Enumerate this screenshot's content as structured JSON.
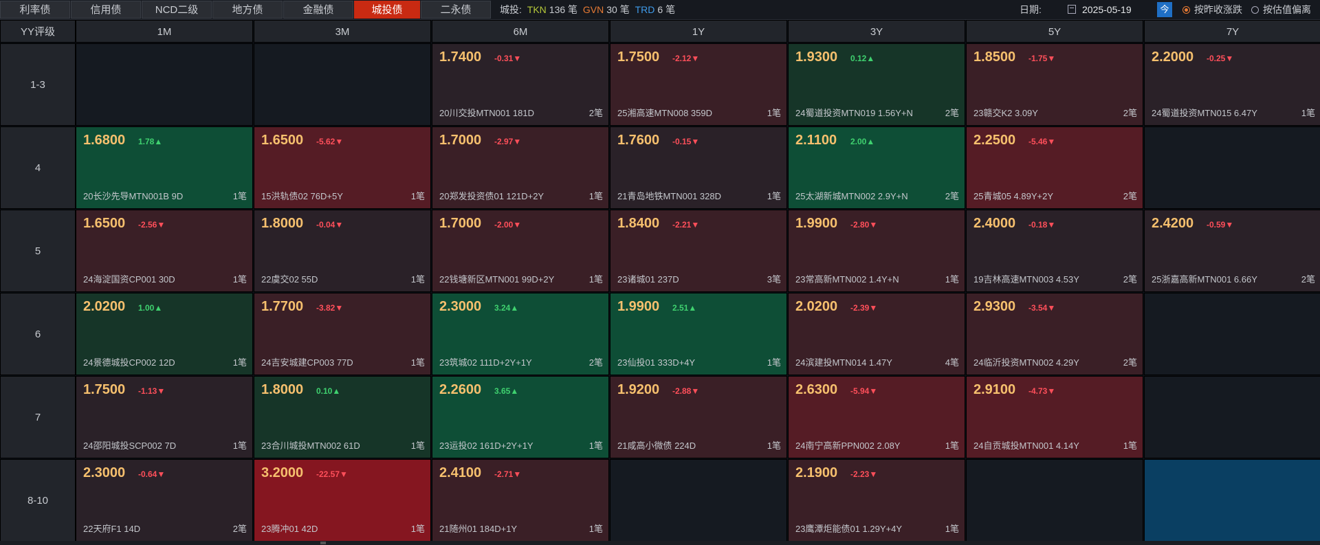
{
  "tabs": [
    {
      "label": "利率债",
      "active": false
    },
    {
      "label": "信用债",
      "active": false
    },
    {
      "label": "NCD二级",
      "active": false
    },
    {
      "label": "地方债",
      "active": false
    },
    {
      "label": "金融债",
      "active": false
    },
    {
      "label": "城投债",
      "active": true
    },
    {
      "label": "二永债",
      "active": false
    }
  ],
  "counts": {
    "prefix": "城投:",
    "tkn_label": "TKN",
    "tkn_value": "136 笔",
    "gvn_label": "GVN",
    "gvn_value": "30 笔",
    "trd_label": "TRD",
    "trd_value": "6 笔"
  },
  "date": {
    "label": "日期:",
    "value": "2025-05-19",
    "today_label": "今"
  },
  "radios": [
    {
      "label": "按昨收涨跌",
      "checked": true
    },
    {
      "label": "按估值偏离",
      "checked": false
    }
  ],
  "grid": {
    "corner": "YY评级",
    "columns": [
      "1M",
      "3M",
      "6M",
      "1Y",
      "3Y",
      "5Y",
      "7Y"
    ],
    "rows": [
      {
        "label": "1-3",
        "cells": [
          null,
          null,
          {
            "yield": "1.7400",
            "change": "-0.31▼",
            "dir": "dn",
            "bond": "20川交投MTN001 181D",
            "count": "2笔",
            "tone": "c-neutral"
          },
          {
            "yield": "1.7500",
            "change": "-2.12▼",
            "dir": "dn",
            "bond": "25湘高速MTN008 359D",
            "count": "1笔",
            "tone": "c-red1"
          },
          {
            "yield": "1.9300",
            "change": "0.12▲",
            "dir": "up",
            "bond": "24蜀道投资MTN019 1.56Y+N",
            "count": "2笔",
            "tone": "c-green1"
          },
          {
            "yield": "1.8500",
            "change": "-1.75▼",
            "dir": "dn",
            "bond": "23赣交K2 3.09Y",
            "count": "2笔",
            "tone": "c-red1"
          },
          {
            "yield": "2.2000",
            "change": "-0.25▼",
            "dir": "dn",
            "bond": "24蜀道投资MTN015 6.47Y",
            "count": "1笔",
            "tone": "c-neutral"
          }
        ]
      },
      {
        "label": "4",
        "cells": [
          {
            "yield": "1.6800",
            "change": "1.78▲",
            "dir": "up",
            "bond": "20长沙先导MTN001B 9D",
            "count": "1笔",
            "tone": "c-green2"
          },
          {
            "yield": "1.6500",
            "change": "-5.62▼",
            "dir": "dn",
            "bond": "15洪轨债02 76D+5Y",
            "count": "1笔",
            "tone": "c-red2"
          },
          {
            "yield": "1.7000",
            "change": "-2.97▼",
            "dir": "dn",
            "bond": "20郑发投资债01 121D+2Y",
            "count": "1笔",
            "tone": "c-red1"
          },
          {
            "yield": "1.7600",
            "change": "-0.15▼",
            "dir": "dn",
            "bond": "21青岛地铁MTN001 328D",
            "count": "1笔",
            "tone": "c-neutral"
          },
          {
            "yield": "2.1100",
            "change": "2.00▲",
            "dir": "up",
            "bond": "25太湖新城MTN002 2.9Y+N",
            "count": "2笔",
            "tone": "c-green2"
          },
          {
            "yield": "2.2500",
            "change": "-5.46▼",
            "dir": "dn",
            "bond": "25青城05 4.89Y+2Y",
            "count": "2笔",
            "tone": "c-red2"
          },
          null
        ]
      },
      {
        "label": "5",
        "cells": [
          {
            "yield": "1.6500",
            "change": "-2.56▼",
            "dir": "dn",
            "bond": "24海淀国资CP001 30D",
            "count": "1笔",
            "tone": "c-red1"
          },
          {
            "yield": "1.8000",
            "change": "-0.04▼",
            "dir": "dn",
            "bond": "22虞交02 55D",
            "count": "1笔",
            "tone": "c-neutral"
          },
          {
            "yield": "1.7000",
            "change": "-2.00▼",
            "dir": "dn",
            "bond": "22钱塘新区MTN001 99D+2Y",
            "count": "1笔",
            "tone": "c-red1"
          },
          {
            "yield": "1.8400",
            "change": "-2.21▼",
            "dir": "dn",
            "bond": "23诸城01 237D",
            "count": "3笔",
            "tone": "c-red1"
          },
          {
            "yield": "1.9900",
            "change": "-2.80▼",
            "dir": "dn",
            "bond": "23常高新MTN002 1.4Y+N",
            "count": "1笔",
            "tone": "c-red1"
          },
          {
            "yield": "2.4000",
            "change": "-0.18▼",
            "dir": "dn",
            "bond": "19吉林高速MTN003 4.53Y",
            "count": "2笔",
            "tone": "c-neutral"
          },
          {
            "yield": "2.4200",
            "change": "-0.59▼",
            "dir": "dn",
            "bond": "25浙嘉高新MTN001 6.66Y",
            "count": "2笔",
            "tone": "c-neutral"
          }
        ]
      },
      {
        "label": "6",
        "cells": [
          {
            "yield": "2.0200",
            "change": "1.00▲",
            "dir": "up",
            "bond": "24景德城投CP002 12D",
            "count": "1笔",
            "tone": "c-green1"
          },
          {
            "yield": "1.7700",
            "change": "-3.82▼",
            "dir": "dn",
            "bond": "24吉安城建CP003 77D",
            "count": "1笔",
            "tone": "c-red1"
          },
          {
            "yield": "2.3000",
            "change": "3.24▲",
            "dir": "up",
            "bond": "23筑城02 111D+2Y+1Y",
            "count": "2笔",
            "tone": "c-green2"
          },
          {
            "yield": "1.9900",
            "change": "2.51▲",
            "dir": "up",
            "bond": "23仙投01 333D+4Y",
            "count": "1笔",
            "tone": "c-green2"
          },
          {
            "yield": "2.0200",
            "change": "-2.39▼",
            "dir": "dn",
            "bond": "24滨建投MTN014 1.47Y",
            "count": "4笔",
            "tone": "c-red1"
          },
          {
            "yield": "2.9300",
            "change": "-3.54▼",
            "dir": "dn",
            "bond": "24临沂投资MTN002 4.29Y",
            "count": "2笔",
            "tone": "c-red1"
          },
          null
        ]
      },
      {
        "label": "7",
        "cells": [
          {
            "yield": "1.7500",
            "change": "-1.13▼",
            "dir": "dn",
            "bond": "24邵阳城投SCP002 7D",
            "count": "1笔",
            "tone": "c-neutral"
          },
          {
            "yield": "1.8000",
            "change": "0.10▲",
            "dir": "up",
            "bond": "23合川城投MTN002 61D",
            "count": "1笔",
            "tone": "c-green1"
          },
          {
            "yield": "2.2600",
            "change": "3.65▲",
            "dir": "up",
            "bond": "23运投02 161D+2Y+1Y",
            "count": "1笔",
            "tone": "c-green2"
          },
          {
            "yield": "1.9200",
            "change": "-2.88▼",
            "dir": "dn",
            "bond": "21咸高小微债 224D",
            "count": "1笔",
            "tone": "c-red1"
          },
          {
            "yield": "2.6300",
            "change": "-5.94▼",
            "dir": "dn",
            "bond": "24南宁高新PPN002 2.08Y",
            "count": "1笔",
            "tone": "c-red2"
          },
          {
            "yield": "2.9100",
            "change": "-4.73▼",
            "dir": "dn",
            "bond": "24自贡城投MTN001 4.14Y",
            "count": "1笔",
            "tone": "c-red2"
          },
          null
        ]
      },
      {
        "label": "8-10",
        "cells": [
          {
            "yield": "2.3000",
            "change": "-0.64▼",
            "dir": "dn",
            "bond": "22天府F1 14D",
            "count": "2笔",
            "tone": "c-neutral"
          },
          {
            "yield": "3.2000",
            "change": "-22.57▼",
            "dir": "dn",
            "bond": "23腾冲01 42D",
            "count": "1笔",
            "tone": "c-red3"
          },
          {
            "yield": "2.4100",
            "change": "-2.71▼",
            "dir": "dn",
            "bond": "21随州01 184D+1Y",
            "count": "1笔",
            "tone": "c-red1"
          },
          null,
          {
            "yield": "2.1900",
            "change": "-2.23▼",
            "dir": "dn",
            "bond": "23鹰潭炬能债01 1.29Y+4Y",
            "count": "1笔",
            "tone": "c-red1"
          },
          null,
          {
            "selected": true
          }
        ]
      }
    ]
  }
}
